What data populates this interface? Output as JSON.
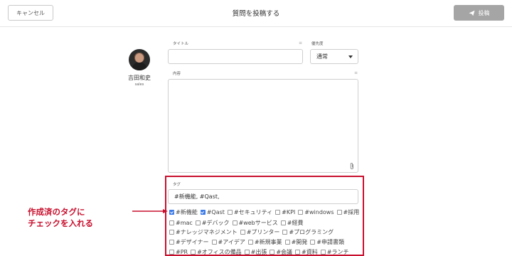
{
  "header": {
    "cancel_label": "キャンセル",
    "title": "質問を投稿する",
    "post_label": "投稿"
  },
  "user": {
    "name": "吉田和史",
    "role": "sales"
  },
  "form": {
    "title_label": "タイトル",
    "title_value": "",
    "priority_label": "優先度",
    "priority_value": "通常",
    "content_label": "内容",
    "content_value": "",
    "required_mark": "≡",
    "tag_label": "タグ",
    "tag_input_value": "#新機能, #Qast,"
  },
  "tags": {
    "rows": [
      [
        {
          "label": "#新機能",
          "checked": true
        },
        {
          "label": "#Qast",
          "checked": true
        },
        {
          "label": "#セキュリティ",
          "checked": false
        },
        {
          "label": "#KPI",
          "checked": false
        },
        {
          "label": "#windows",
          "checked": false
        },
        {
          "label": "#採用",
          "checked": false
        }
      ],
      [
        {
          "label": "#mac",
          "checked": false
        },
        {
          "label": "#デバック",
          "checked": false
        },
        {
          "label": "#webサービス",
          "checked": false
        },
        {
          "label": "#経費",
          "checked": false
        }
      ],
      [
        {
          "label": "#ナレッジマネジメント",
          "checked": false
        },
        {
          "label": "#プリンター",
          "checked": false
        },
        {
          "label": "#プログラミング",
          "checked": false
        }
      ],
      [
        {
          "label": "#デザイナー",
          "checked": false
        },
        {
          "label": "#アイデア",
          "checked": false
        },
        {
          "label": "#新規事業",
          "checked": false
        },
        {
          "label": "#開発",
          "checked": false
        },
        {
          "label": "#申請書類",
          "checked": false
        }
      ],
      [
        {
          "label": "#PR",
          "checked": false
        },
        {
          "label": "#オフィスの備品",
          "checked": false
        },
        {
          "label": "#出張",
          "checked": false
        },
        {
          "label": "#会議",
          "checked": false
        },
        {
          "label": "#資料",
          "checked": false
        },
        {
          "label": "#ランチ",
          "checked": false
        }
      ]
    ]
  },
  "annotation": {
    "line1": "作成済のタグに",
    "line2": "チェックを入れる"
  },
  "colors": {
    "accent_red": "#c8102e",
    "checkbox_blue": "#3d7be8",
    "post_button_gray": "#a5a5a5"
  },
  "icons": {
    "post": "paper-plane-icon",
    "attach": "paperclip-icon",
    "dropdown": "caret-down-icon",
    "arrow": "arrow-right-icon"
  }
}
